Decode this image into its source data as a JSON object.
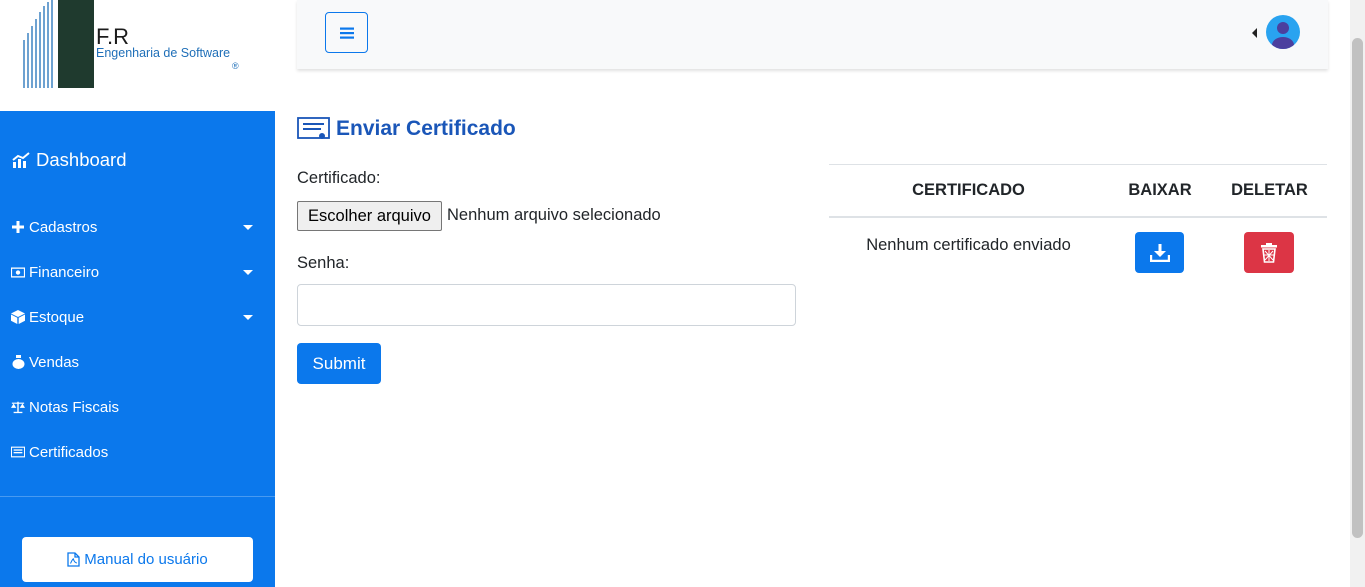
{
  "brand": {
    "name": "F.R",
    "subtitle": "Engenharia de Software",
    "registered_mark": "®"
  },
  "sidebar": {
    "dashboard_label": "Dashboard",
    "items": [
      {
        "label": "Cadastros",
        "icon": "plus-icon",
        "has_dropdown": true
      },
      {
        "label": "Financeiro",
        "icon": "money-bill-icon",
        "has_dropdown": true
      },
      {
        "label": "Estoque",
        "icon": "box-icon",
        "has_dropdown": true
      },
      {
        "label": "Vendas",
        "icon": "money-bag-icon",
        "has_dropdown": false
      },
      {
        "label": "Notas Fiscais",
        "icon": "balance-scale-icon",
        "has_dropdown": false
      },
      {
        "label": "Certificados",
        "icon": "certificate-icon",
        "has_dropdown": false
      }
    ],
    "manual_button_label": "Manual do usuário"
  },
  "topbar": {
    "menu_icon": "hamburger-icon",
    "user_icon": "user-avatar-icon"
  },
  "main": {
    "title": "Enviar Certificado",
    "certificate_label": "Certificado:",
    "file_button_label": "Escolher arquivo",
    "file_status": "Nenhum arquivo selecionado",
    "password_label": "Senha:",
    "password_value": "",
    "submit_label": "Submit"
  },
  "table": {
    "headers": [
      "CERTIFICADO",
      "BAIXAR",
      "DELETAR"
    ],
    "empty_message": "Nenhum certificado enviado"
  },
  "colors": {
    "primary": "#0b78ec",
    "danger": "#dc3545",
    "title_blue": "#1a56b8",
    "topbar_bg": "#f8f9fa"
  }
}
